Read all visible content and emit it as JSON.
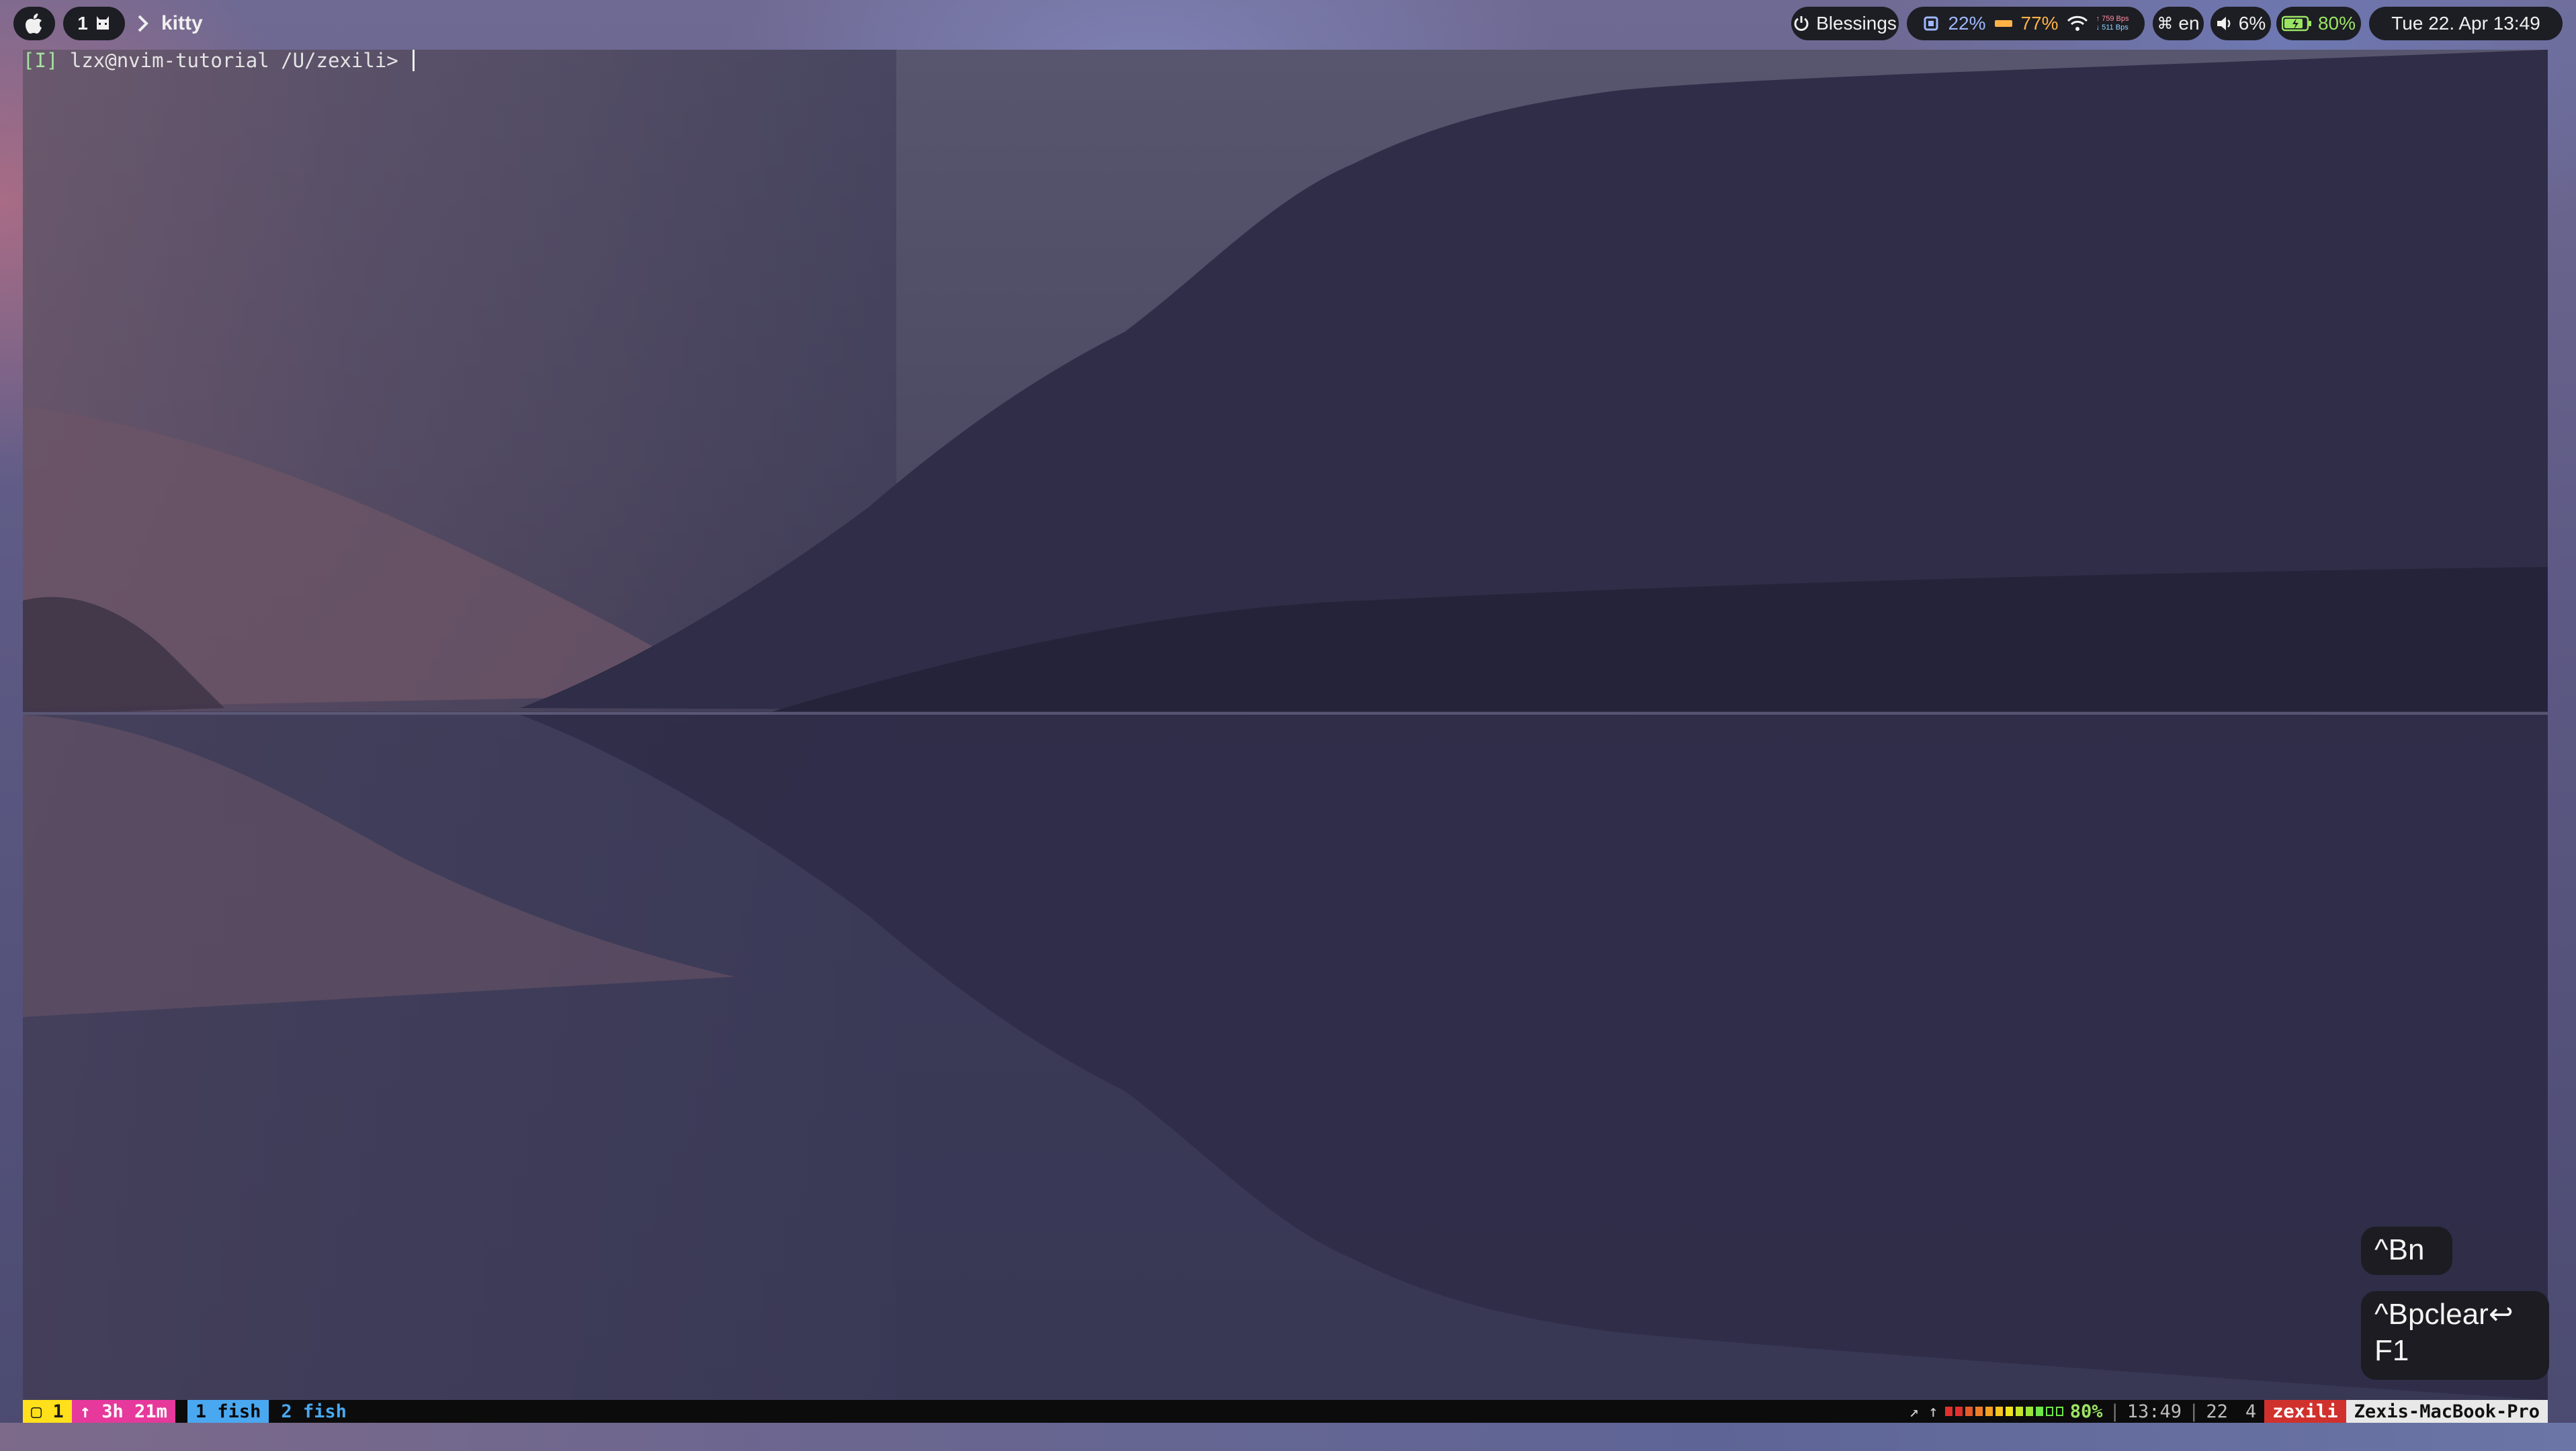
{
  "topbar": {
    "space_number": "1",
    "space_icon": "kitty-cat-icon",
    "app_name": "kitty",
    "blessings": "Blessings",
    "cpu": "22%",
    "memory": "77%",
    "net_up": "759 Bps",
    "net_down": "511 Bps",
    "input_source": "en",
    "volume": "6%",
    "battery": "80%",
    "datetime": "Tue 22. Apr 13:49"
  },
  "terminal": {
    "mode": "[I]",
    "user_host": "lzx@nvim-tutorial",
    "path": "/U/zexili",
    "prompt_char": ">"
  },
  "keys": {
    "popup1": "^Bn",
    "popup2_line1": "^Bpclear↩",
    "popup2_line2": "F1"
  },
  "tmux": {
    "session": "▢ 1",
    "uptime": "↑ 3h 21m",
    "window1": "1 fish",
    "window2": "2 fish",
    "arrows": "↗ ↑",
    "battery_level": 0.8,
    "battery_pct": "80%",
    "time": "13:49",
    "date_day": "22",
    "date_num": "4",
    "user": "zexili",
    "host": "Zexis-MacBook-Pro"
  },
  "colors": {
    "tmux_session": "#ffe01a",
    "tmux_uptime": "#e6399b",
    "tmux_window_active": "#4aa8f0",
    "tmux_window_inactive_text": "#4aa8f0",
    "tmux_user": "#d0312d",
    "tmux_host": "#e8e8e8",
    "battery_green": "#9be564"
  }
}
